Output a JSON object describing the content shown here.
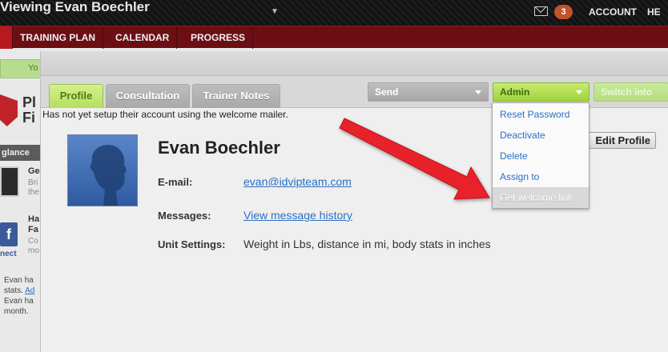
{
  "topbar": {
    "title": "Viewing Evan Boechler",
    "messages_count": "3",
    "account_label": "ACCOUNT",
    "help_label": "HE"
  },
  "nav": {
    "items": [
      "TRAINING PLAN",
      "CALENDAR",
      "PROGRESS"
    ]
  },
  "background": {
    "green_bar_text": "Yo",
    "brand_text_1": "Pl",
    "brand_text_2": "Fi",
    "glance_label": "glance",
    "ge_title": "Ge",
    "ge_line1": "Bri",
    "ge_line2": "the",
    "ha_title_1": "Ha",
    "ha_title_2": "Fa",
    "co_line1": "Co",
    "co_line2": "mo",
    "fb_text": "nect",
    "evan_line1": "Evan ha",
    "evan_line2": "stats.",
    "evan_line2_link": "Ad",
    "evan_line3": "Evan ha",
    "evan_line4": "month."
  },
  "modal": {
    "tabs": [
      "Profile",
      "Consultation",
      "Trainer Notes"
    ],
    "active_tab": "Profile",
    "send_label": "Send",
    "admin_label": "Admin",
    "switch_label": "Switch into",
    "notice": "Has not yet setup their account using the welcome mailer.",
    "edit_profile_label": "Edit Profile",
    "profile": {
      "name": "Evan Boechler",
      "email_label": "E-mail:",
      "email": "evan@idvipteam.com",
      "messages_label": "Messages:",
      "messages_link": "View message history",
      "unit_label": "Unit Settings:",
      "unit_value": "Weight in Lbs, distance in mi, body stats in inches"
    },
    "admin_menu": [
      "Reset Password",
      "Deactivate",
      "Delete",
      "Assign to",
      "Get welcome link"
    ],
    "highlighted_item": "Get welcome link"
  },
  "colors": {
    "accent_green": "#b4de5e",
    "nav_red": "#6b0f14",
    "link_blue": "#2a6fc4",
    "annotation_red": "#e8222a"
  }
}
